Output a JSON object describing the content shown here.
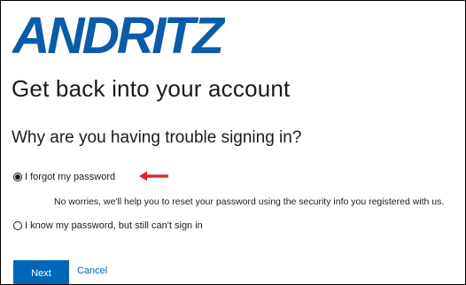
{
  "brand": {
    "logo_text": "ANDRITZ",
    "logo_color": "#0a5ba8"
  },
  "page": {
    "title": "Get back into your account",
    "question": "Why are you having trouble signing in?"
  },
  "options": [
    {
      "label": "I forgot my password",
      "selected": true,
      "help_text": "No worries, we'll help you to reset your password using the security info you registered with us."
    },
    {
      "label": "I know my password, but still can't sign in",
      "selected": false
    }
  ],
  "annotation": {
    "arrow_color": "#d9262b",
    "icon": "red-arrow-left-icon"
  },
  "actions": {
    "next_label": "Next",
    "cancel_label": "Cancel",
    "accent_color": "#0067b8"
  }
}
